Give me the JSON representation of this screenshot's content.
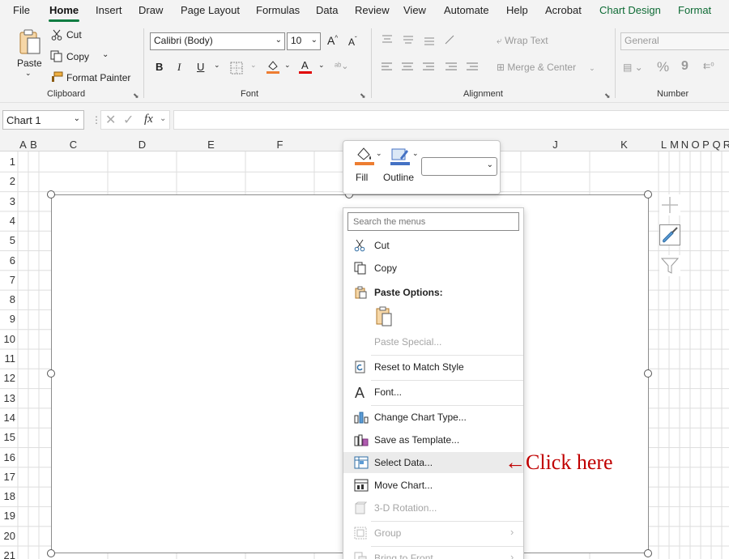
{
  "menu_tabs": [
    "File",
    "Home",
    "Insert",
    "Draw",
    "Page Layout",
    "Formulas",
    "Data",
    "Review",
    "View",
    "Automate",
    "Help",
    "Acrobat",
    "Chart Design",
    "Format"
  ],
  "clipboard": {
    "paste": "Paste",
    "cut": "Cut",
    "copy": "Copy",
    "format_painter": "Format Painter",
    "group": "Clipboard"
  },
  "font": {
    "name": "Calibri (Body)",
    "size": "10",
    "bold": "B",
    "italic": "I",
    "underline": "U",
    "grow": "A",
    "shrink": "A",
    "group": "Font"
  },
  "alignment": {
    "wrap_text": "Wrap Text",
    "merge_center": "Merge & Center",
    "group": "Alignment"
  },
  "number": {
    "format": "General",
    "percent": "%",
    "comma": "9",
    "group": "Number"
  },
  "formula_bar": {
    "name_box": "Chart 1",
    "fx": "fx",
    "value": ""
  },
  "columns": [
    "A",
    "B",
    "C",
    "D",
    "E",
    "F",
    "J",
    "K",
    "L",
    "M",
    "N",
    "O",
    "P",
    "Q",
    "R"
  ],
  "rows": [
    "1",
    "2",
    "3",
    "4",
    "5",
    "6",
    "7",
    "8",
    "9",
    "10",
    "11",
    "12",
    "13",
    "14",
    "15",
    "16",
    "17",
    "18",
    "19",
    "20",
    "21"
  ],
  "mini_toolbar": {
    "fill": "Fill",
    "outline": "Outline",
    "dropdown": ""
  },
  "context_menu": {
    "search_placeholder": "Search the menus",
    "cut": "Cut",
    "copy": "Copy",
    "paste_options": "Paste Options:",
    "paste_special": "Paste Special...",
    "reset": "Reset to Match Style",
    "font": "Font...",
    "change_type": "Change Chart Type...",
    "save_template": "Save as Template...",
    "select_data": "Select Data...",
    "move_chart": "Move Chart...",
    "rotation": "3-D Rotation...",
    "group": "Group",
    "bring_front": "Bring to Front"
  },
  "annotation": "←Click here",
  "colors": {
    "accent": "#107c41",
    "context_tab": "#0e6b35",
    "annotation": "#c00000",
    "fill_swatch": "#ed7d31",
    "outline_swatch": "#4472c4",
    "font_color": "#e00000"
  }
}
